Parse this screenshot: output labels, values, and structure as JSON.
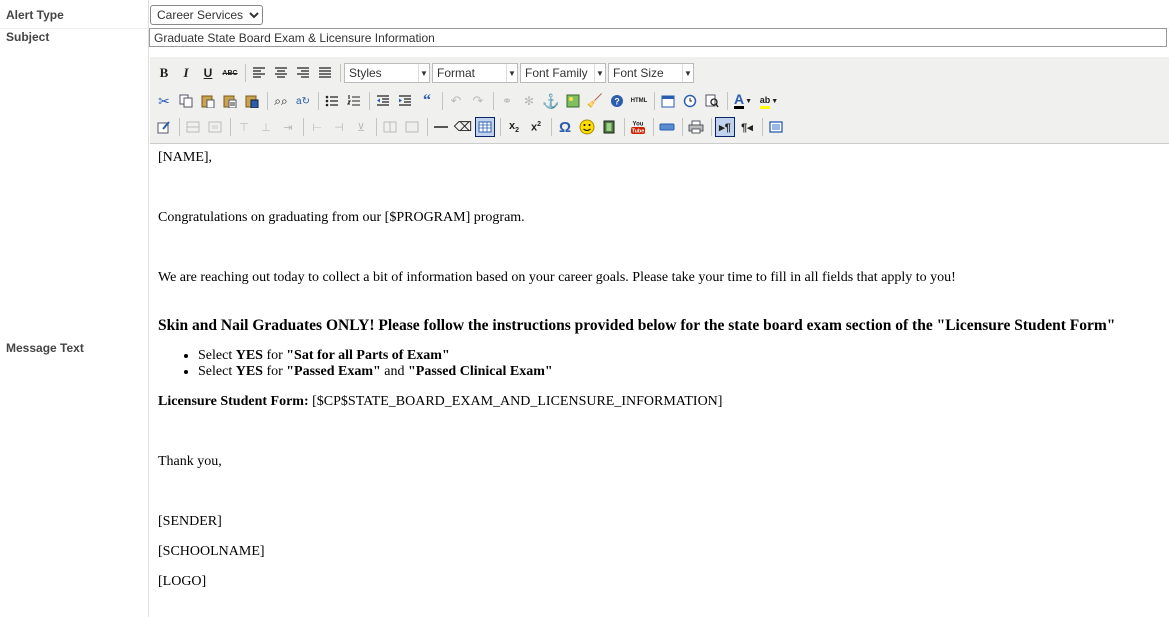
{
  "form": {
    "alert_type_label": "Alert Type",
    "alert_type_value": "Career Services",
    "subject_label": "Subject",
    "subject_value": "Graduate State Board Exam & Licensure Information",
    "message_label": "Message Text"
  },
  "toolbar": {
    "bold": "B",
    "italic": "I",
    "underline": "U",
    "strike": "ABC",
    "styles": "Styles",
    "format": "Format",
    "font_family": "Font Family",
    "font_size": "Font Size"
  },
  "editor": {
    "greeting": "[NAME],",
    "congrats": "Congratulations on graduating from our [$PROGRAM] program.",
    "reaching": "We are reaching out today to collect a bit of information based on your career goals. Please take your time to fill in all fields that apply to you!",
    "heading": "Skin and Nail Graduates ONLY!  Please follow the instructions provided below for the state board exam section of the \"Licensure Student Form\"",
    "b1_select": "Select ",
    "b1_yes": "YES",
    "b1_for": " for ",
    "b1_item": "\"Sat for all Parts of Exam\"",
    "b2_select": "Select ",
    "b2_yes": "YES",
    "b2_for": " for ",
    "b2_item1": "\"Passed Exam\"",
    "b2_and": " and ",
    "b2_item2": "\"Passed Clinical Exam\"",
    "form_label": "Licensure Student Form:",
    "form_value": " [$CP$STATE_BOARD_EXAM_AND_LICENSURE_INFORMATION]",
    "thanks": "Thank you,",
    "sender": "[SENDER]",
    "school": "[SCHOOLNAME]",
    "logo": "[LOGO]"
  },
  "colors": {
    "toolbar_bg": "#f0f0ee",
    "active_border": "#0a246a",
    "active_bg": "#c1d2ee",
    "icon_blue": "#2a5db0",
    "icon_red": "#cc2200"
  }
}
